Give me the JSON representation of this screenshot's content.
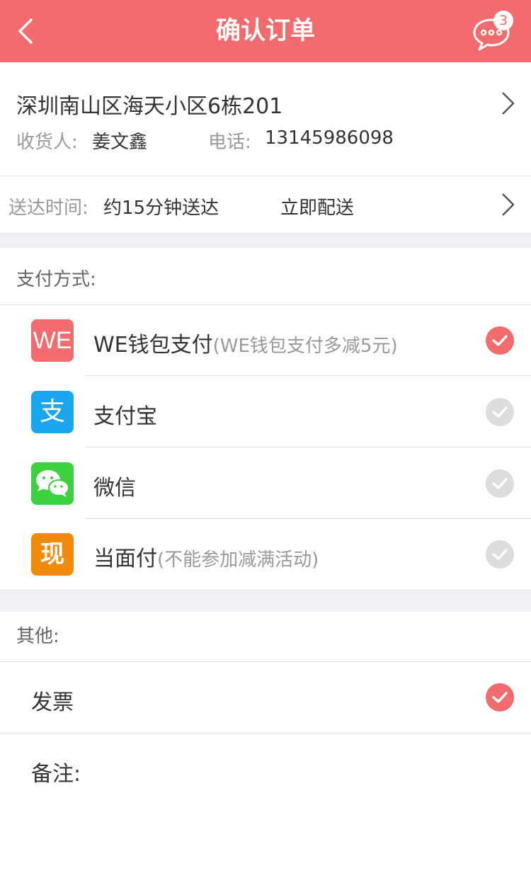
{
  "header": {
    "title": "确认订单",
    "message_count": "3"
  },
  "address": {
    "line": "深圳南山区海天小区6栋201",
    "receiver_label": "收货人:",
    "receiver_name": "姜文鑫",
    "phone_label": "电话:",
    "phone": "13145986098"
  },
  "delivery": {
    "label": "送达时间:",
    "estimate": "约15分钟送达",
    "mode": "立即配送"
  },
  "payment": {
    "section_title": "支付方式:",
    "methods": [
      {
        "icon": "we-wallet-icon",
        "icon_text": "WE",
        "name": "WE钱包支付",
        "note": "(WE钱包支付多减5元)",
        "selected": true
      },
      {
        "icon": "alipay-icon",
        "icon_text": "支",
        "name": "支付宝",
        "note": "",
        "selected": false
      },
      {
        "icon": "wechat-icon",
        "icon_text": "",
        "name": "微信",
        "note": "",
        "selected": false
      },
      {
        "icon": "cash-icon",
        "icon_text": "现",
        "name": "当面付",
        "note": "(不能参加减满活动)",
        "selected": false
      }
    ]
  },
  "other": {
    "section_title": "其他:",
    "invoice_label": "发票",
    "invoice_selected": true,
    "remark_label": "备注:"
  },
  "colors": {
    "brand": "#f26c6d",
    "checked": "#f26c6d",
    "unchecked": "#dcdcdc",
    "we_wallet": "#f26c6d",
    "alipay": "#1ba6f0",
    "wechat": "#3dd13f",
    "cash": "#f08a0c",
    "section_gap": "#eef0f3"
  }
}
